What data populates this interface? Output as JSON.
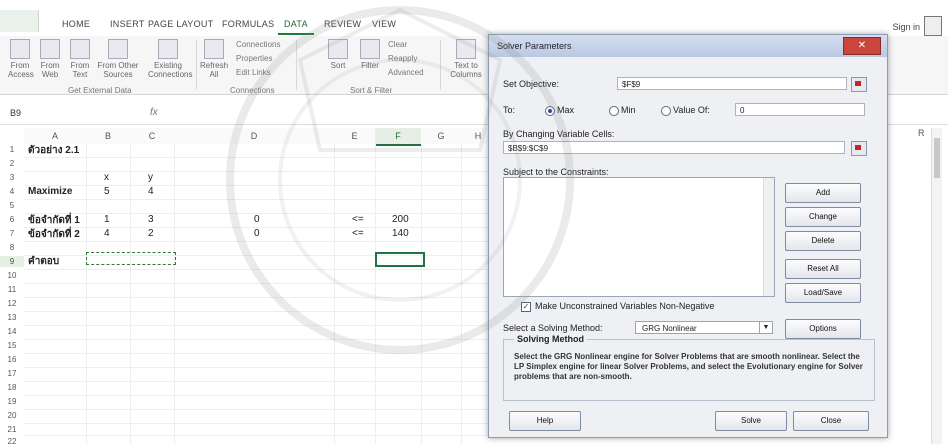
{
  "ribbon": {
    "tabs": [
      "HOME",
      "INSERT",
      "PAGE LAYOUT",
      "FORMULAS",
      "DATA",
      "REVIEW",
      "VIEW"
    ],
    "active_tab": "DATA",
    "sign_in": "Sign in",
    "buttons": {
      "from_access": "From Access",
      "from_web": "From Web",
      "from_text": "From Text",
      "from_other_sources": "From Other Sources",
      "existing_connections": "Existing Connections",
      "refresh_all": "Refresh All",
      "sort": "Sort",
      "filter": "Filter",
      "text_to_columns": "Text to Columns"
    },
    "small_commands": {
      "connections": "Connections",
      "properties": "Properties",
      "edit_links": "Edit Links",
      "clear": "Clear",
      "reapply": "Reapply",
      "advanced": "Advanced"
    },
    "groups": [
      "Get External Data",
      "Connections",
      "Sort & Filter"
    ]
  },
  "formula_bar": {
    "name_box": "B9",
    "fx": "fx"
  },
  "sheet": {
    "columns": [
      "A",
      "B",
      "C",
      "D",
      "E",
      "F",
      "G",
      "H",
      "R"
    ],
    "selected_column": "F",
    "rows": [
      "1",
      "2",
      "3",
      "4",
      "5",
      "6",
      "7",
      "8",
      "9",
      "10",
      "11",
      "12",
      "13",
      "14",
      "15",
      "16",
      "17",
      "18",
      "19",
      "20",
      "21",
      "22"
    ],
    "selected_row": "9",
    "cells": {
      "a1": "ตัวอย่าง 2.1",
      "b3": "x",
      "c3": "y",
      "a4": "Maximize",
      "b4": "5",
      "c4": "4",
      "a6": "ข้อจำกัดที่ 1",
      "b6": "1",
      "c6": "3",
      "d6": "0",
      "e6": "<=",
      "f6": "200",
      "a7": "ข้อจำกัดที่ 2",
      "b7": "4",
      "c7": "2",
      "d7": "0",
      "e7": "<=",
      "f7": "140",
      "a9": "คำตอบ"
    }
  },
  "solver": {
    "title": "Solver Parameters",
    "set_objective_label": "Set Objective:",
    "set_objective_value": "$F$9",
    "to_label": "To:",
    "max_label": "Max",
    "min_label": "Min",
    "value_of_label": "Value Of:",
    "value_of_value": "0",
    "changing_cells_label": "By Changing Variable Cells:",
    "changing_cells_value": "$B$9:$C$9",
    "constraints_label": "Subject to the Constraints:",
    "buttons": {
      "add": "Add",
      "change": "Change",
      "delete": "Delete",
      "reset_all": "Reset All",
      "load_save": "Load/Save",
      "options": "Options",
      "help": "Help",
      "solve": "Solve",
      "close": "Close"
    },
    "nonneg_label": "Make Unconstrained Variables Non-Negative",
    "nonneg_checked": true,
    "method_label": "Select a Solving Method:",
    "method_value": "GRG Nonlinear",
    "solving_method_title": "Solving Method",
    "solving_method_text": "Select the GRG Nonlinear engine for Solver Problems that are smooth nonlinear. Select the LP Simplex engine for linear Solver Problems, and select the Evolutionary engine for Solver problems that are non-smooth."
  }
}
